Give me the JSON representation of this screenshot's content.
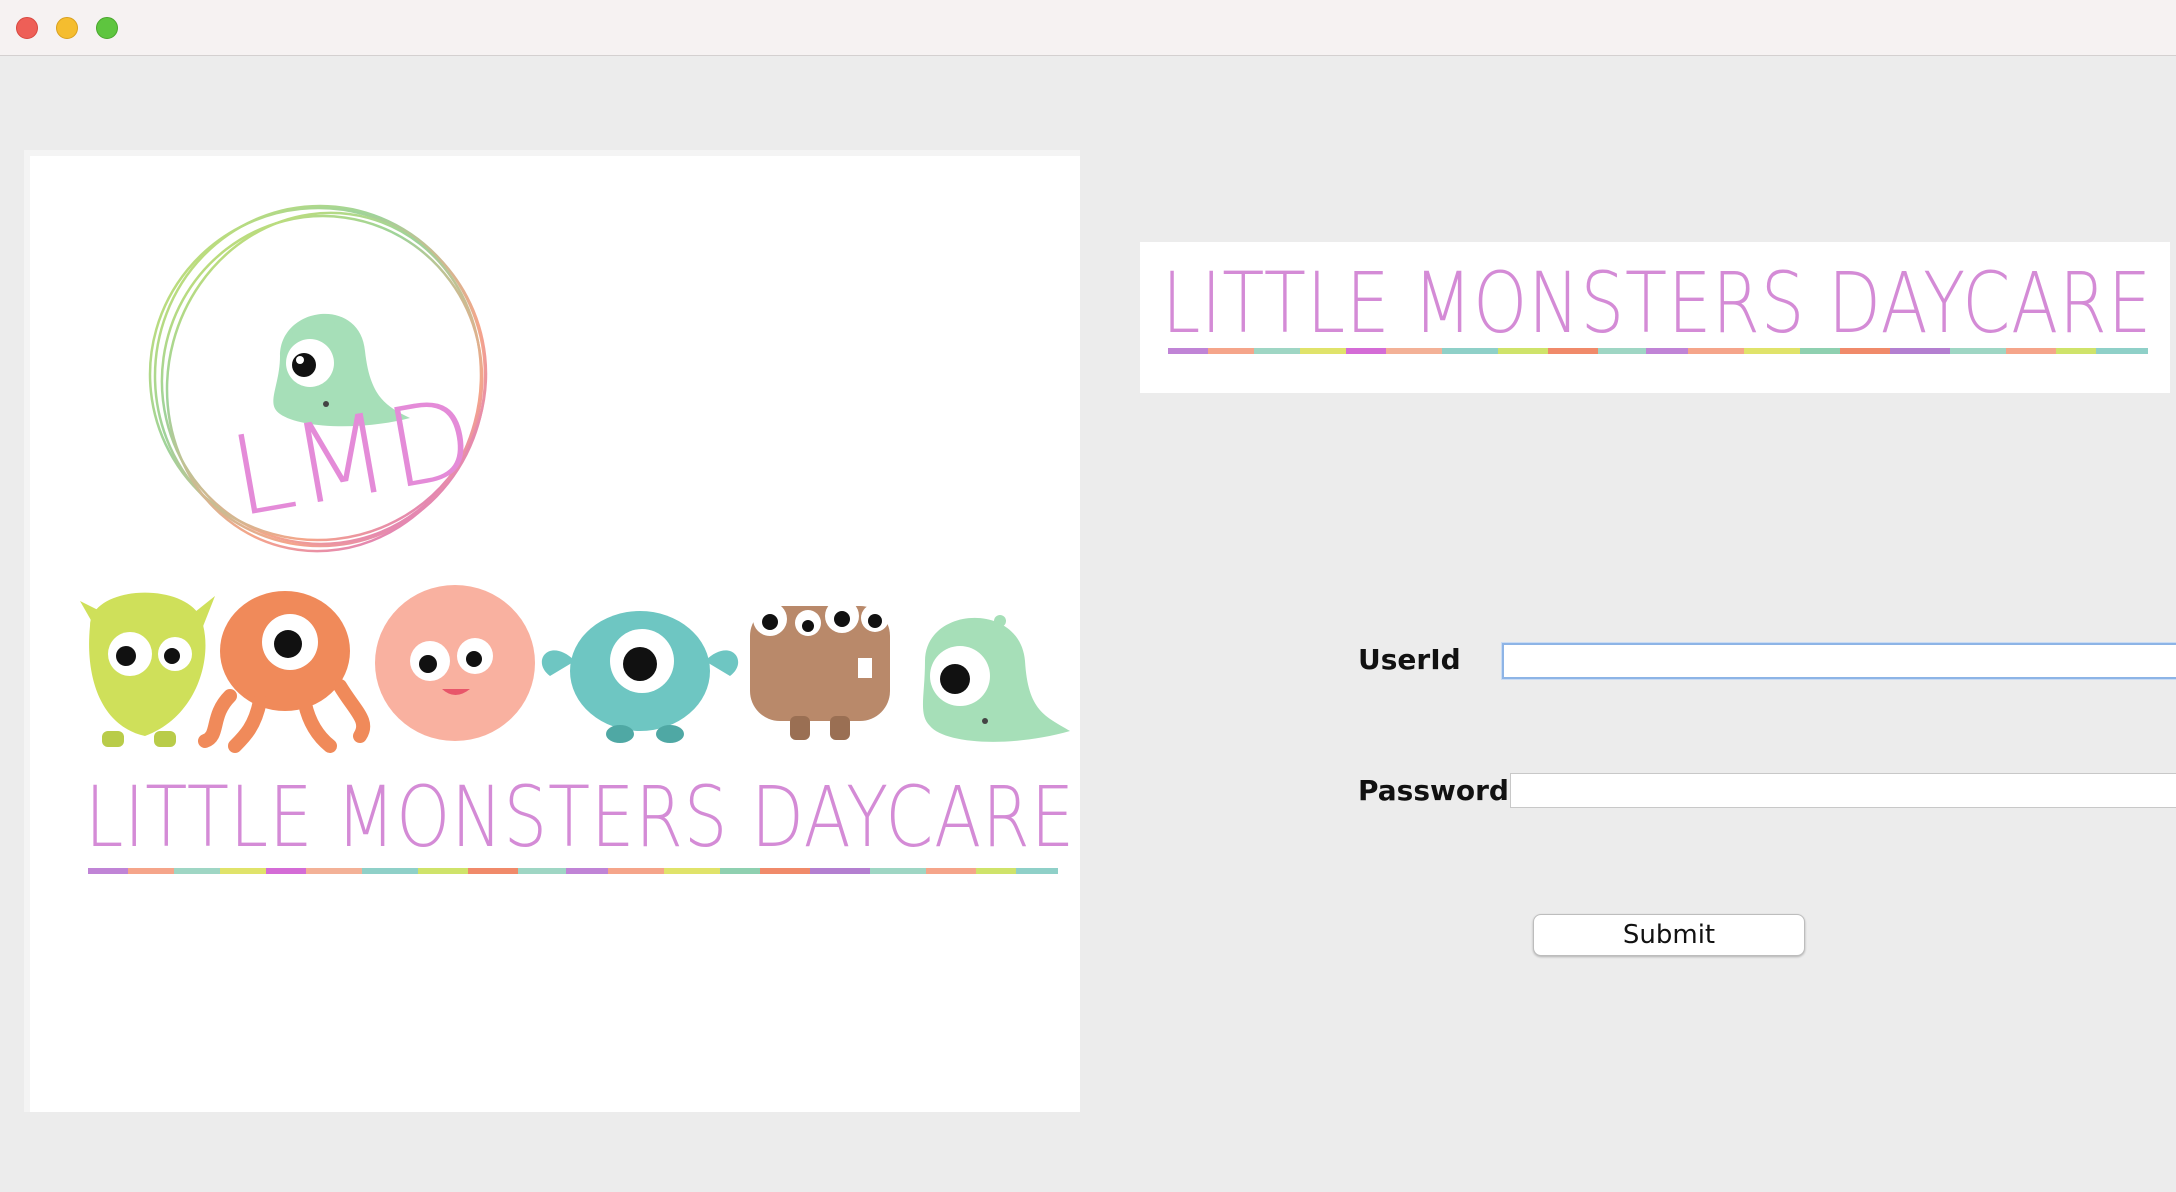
{
  "window": {
    "controls": [
      "close",
      "minimize",
      "maximize"
    ]
  },
  "logo": {
    "monogram": "LMD",
    "brand": "LITTLE MONSTERS DAYCARE"
  },
  "banner": {
    "brand": "LITTLE MONSTERS DAYCARE"
  },
  "form": {
    "userid_label": "UserId",
    "userid_value": "",
    "password_label": "Password",
    "password_value": "",
    "submit_label": "Submit"
  },
  "colors": {
    "close": "#ee5f57",
    "minimize": "#f5bd2f",
    "maximize": "#5ec53f",
    "focus_ring": "#8db4e6",
    "brand_stripe": [
      "#c084d6",
      "#f5a58a",
      "#9fd6c4",
      "#e0e36a",
      "#d46cd6",
      "#f3b197",
      "#8fd0c8",
      "#cfe36a",
      "#f08a6a",
      "#b37fd0"
    ]
  }
}
